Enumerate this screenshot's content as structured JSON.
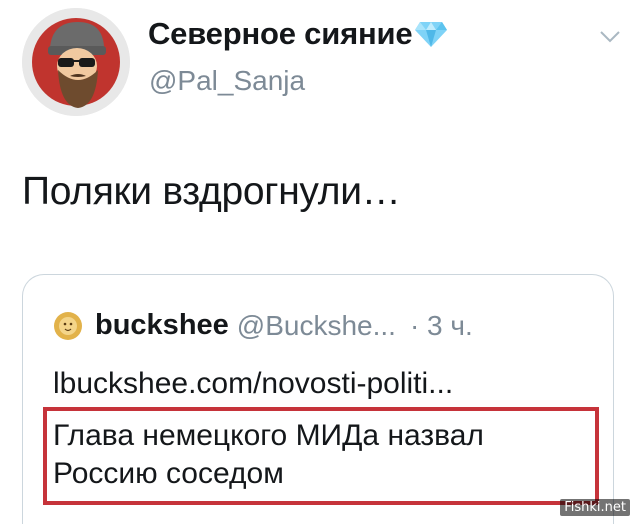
{
  "tweet": {
    "author": {
      "display_name": "Северное сияние",
      "badge_icon": "diamond-icon",
      "handle": "@Pal_Sanja",
      "avatar_icon": "bearded-man-sunglasses-avatar"
    },
    "menu_icon": "chevron-down-icon",
    "text": "Поляки вздрогнули…",
    "quote": {
      "avatar_icon": "lion-icon",
      "name": "buckshee",
      "handle": "@Buckshe...",
      "time": "· 3 ч.",
      "link": "lbuckshee.com/novosti-politi...",
      "headline_line1": "Глава немецкого МИДа назвал",
      "headline_line2": "Россию соседом",
      "highlight_color": "#c6333a"
    }
  },
  "watermark": "Fishki.net"
}
